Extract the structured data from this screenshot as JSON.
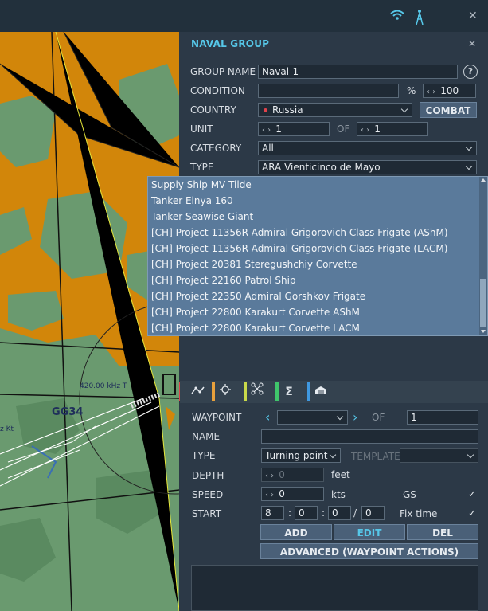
{
  "topbar": {
    "wifi_icon": "wifi-icon",
    "signal_icon": "radio-tower-icon",
    "close": "✕"
  },
  "panel": {
    "title": "NAVAL GROUP",
    "close": "✕",
    "group_name": {
      "label": "GROUP NAME",
      "value": "Naval-1",
      "help": "?"
    },
    "condition": {
      "label": "CONDITION",
      "value": "",
      "percent": "%",
      "amount": "100"
    },
    "country": {
      "label": "COUNTRY",
      "value": "Russia",
      "combat": "COMBAT",
      "flag_color": "#e0424b"
    },
    "unit": {
      "label": "UNIT",
      "value": "1",
      "of": "OF",
      "total": "1"
    },
    "category": {
      "label": "CATEGORY",
      "value": "All"
    },
    "type": {
      "label": "TYPE",
      "value": "ARA Vienticinco de Mayo"
    }
  },
  "type_options": [
    "Supply Ship MV Tilde",
    "Tanker Elnya 160",
    "Tanker Seawise Giant",
    "[CH] Project 11356R Admiral Grigorovich Class Frigate (AShM)",
    "[CH] Project 11356R Admiral Grigorovich Class Frigate (LACM)",
    "[CH] Project 20381 Steregushchiy Corvette",
    "[CH] Project 22160 Patrol Ship",
    "[CH] Project 22350 Admiral Gorshkov Frigate",
    "[CH] Project 22800 Karakurt Corvette AShM",
    "[CH] Project 22800 Karakurt Corvette LACM"
  ],
  "tabs": [
    {
      "icon": "route-icon",
      "color": "#e0424b"
    },
    {
      "icon": "target-icon",
      "color": "#e8a03c"
    },
    {
      "icon": "drone-icon",
      "color": "#c9d94a"
    },
    {
      "icon": "sum-icon",
      "color": "#3fc56b"
    },
    {
      "icon": "cargo-icon",
      "color": "#3f98e0"
    }
  ],
  "waypoint": {
    "label": "WAYPOINT",
    "value": "",
    "of": "OF",
    "total": "1",
    "name_label": "NAME",
    "name_value": "",
    "type_label": "TYPE",
    "type_value": "Turning point",
    "template_label": "TEMPLATE",
    "template_value": "",
    "depth_label": "DEPTH",
    "depth_value": "0",
    "depth_unit": "feet",
    "speed_label": "SPEED",
    "speed_value": "0",
    "speed_unit": "kts",
    "gs_label": "GS",
    "start_label": "START",
    "start_h": "8",
    "start_m": "0",
    "start_s": "0",
    "start_d": "0",
    "fixtime_label": "Fix time",
    "add": "ADD",
    "edit": "EDIT",
    "del": "DEL",
    "advanced": "ADVANCED (WAYPOINT ACTIONS)"
  },
  "map": {
    "labels": [
      "GG34",
      "420.00 kHz T",
      "z Kt"
    ]
  }
}
